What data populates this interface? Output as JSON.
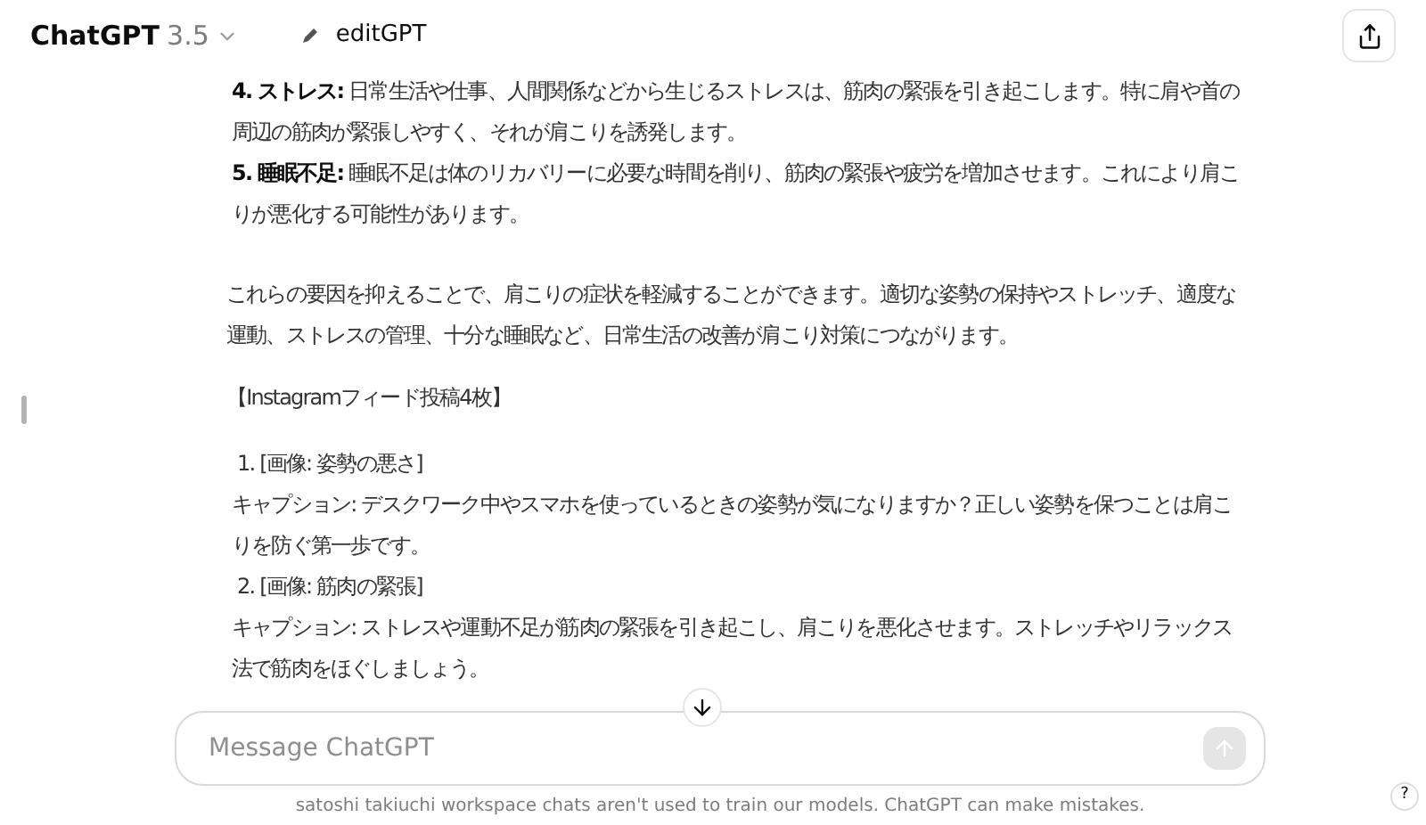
{
  "header": {
    "model_name": "ChatGPT",
    "model_version": "3.5",
    "gpt_link": "editGPT"
  },
  "blocks": [
    {
      "kind": "labeled",
      "label": "4. ストレス:",
      "text": "日常生活や仕事、人間関係などから生じるストレスは、筋肉の緊張を引き起こします。特に肩や首の周辺の筋肉が緊張しやすく、それが肩こりを誘発します。"
    },
    {
      "kind": "labeled",
      "label": "5. 睡眠不足:",
      "text": "睡眠不足は体のリカバリーに必要な時間を削り、筋肉の緊張や疲労を増加させます。これにより肩こりが悪化する可能性があります。"
    },
    {
      "kind": "paragraph",
      "text": "これらの要因を抑えることで、肩こりの症状を軽減することができます。適切な姿勢の保持やストレッチ、適度な運動、ストレスの管理、十分な睡眠など、日常生活の改善が肩こり対策につながります。"
    },
    {
      "kind": "paragraph",
      "text": "【Instagramフィード投稿4枚】"
    },
    {
      "kind": "item",
      "text": "1. [画像: 姿勢の悪さ]"
    },
    {
      "kind": "line",
      "text": "キャプション: デスクワーク中やスマホを使っているときの姿勢が気になりますか？正しい姿勢を保つことは肩こりを防ぐ第一歩です。"
    },
    {
      "kind": "item",
      "text": "2. [画像: 筋肉の緊張]"
    },
    {
      "kind": "line",
      "text": "キャプション: ストレスや運動不足が筋肉の緊張を引き起こし、肩こりを悪化させます。ストレッチやリラックス法で筋肉をほぐしましょう。"
    }
  ],
  "composer": {
    "placeholder": "Message ChatGPT",
    "send_disabled": true
  },
  "footer": "satoshi takiuchi workspace chats aren't used to train our models. ChatGPT can make mistakes.",
  "help": "?"
}
